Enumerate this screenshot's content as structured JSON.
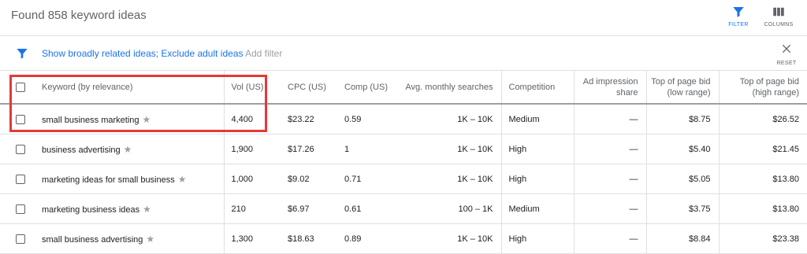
{
  "header": {
    "title": "Found 858 keyword ideas",
    "filter_label": "FILTER",
    "columns_label": "COLUMNS"
  },
  "filter_bar": {
    "active_filters": "Show broadly related ideas; Exclude adult ideas",
    "add_filter": "Add filter",
    "reset_label": "RESET"
  },
  "table": {
    "headers": {
      "keyword": "Keyword (by relevance)",
      "vol": "Vol (US)",
      "cpc": "CPC (US)",
      "comp": "Comp (US)",
      "avg": "Avg. monthly searches",
      "competition": "Competition",
      "ad_impression": "Ad impression share",
      "bid_low": "Top of page bid (low range)",
      "bid_high": "Top of page bid (high range)"
    },
    "rows": [
      {
        "keyword": "small business marketing",
        "vol": "4,400",
        "cpc": "$23.22",
        "comp": "0.59",
        "avg": "1K – 10K",
        "competition": "Medium",
        "ad_impression": "—",
        "bid_low": "$8.75",
        "bid_high": "$26.52"
      },
      {
        "keyword": "business advertising",
        "vol": "1,900",
        "cpc": "$17.26",
        "comp": "1",
        "avg": "1K – 10K",
        "competition": "High",
        "ad_impression": "—",
        "bid_low": "$5.40",
        "bid_high": "$21.45"
      },
      {
        "keyword": "marketing ideas for small business",
        "vol": "1,000",
        "cpc": "$9.02",
        "comp": "0.71",
        "avg": "1K – 10K",
        "competition": "High",
        "ad_impression": "—",
        "bid_low": "$5.05",
        "bid_high": "$13.80"
      },
      {
        "keyword": "marketing business ideas",
        "vol": "210",
        "cpc": "$6.97",
        "comp": "0.61",
        "avg": "100 – 1K",
        "competition": "Medium",
        "ad_impression": "—",
        "bid_low": "$3.75",
        "bid_high": "$13.80"
      },
      {
        "keyword": "small business advertising",
        "vol": "1,300",
        "cpc": "$18.63",
        "comp": "0.89",
        "avg": "1K – 10K",
        "competition": "High",
        "ad_impression": "—",
        "bid_low": "$8.84",
        "bid_high": "$23.38"
      }
    ]
  },
  "icons": {
    "filter": "filter-funnel-icon",
    "columns": "columns-icon",
    "reset": "close-icon",
    "star": "star-icon"
  },
  "colors": {
    "accent": "#1a73e8",
    "highlight": "#e53935",
    "muted": "#5f6368"
  }
}
